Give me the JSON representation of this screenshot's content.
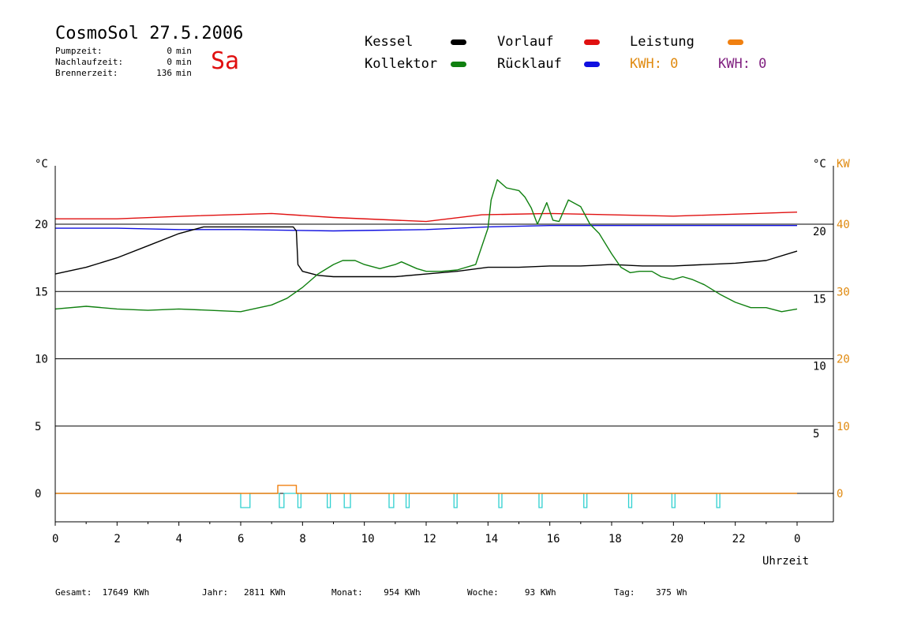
{
  "header": {
    "title": "CosmoSol 27.5.2006",
    "day": "Sa",
    "day_color": "#e01010",
    "info": [
      {
        "label": "Pumpzeit:",
        "value": "0",
        "unit": "min"
      },
      {
        "label": "Nachlaufzeit:",
        "value": "0",
        "unit": "min"
      },
      {
        "label": "Brennerzeit:",
        "value": "136",
        "unit": "min"
      }
    ]
  },
  "legend": {
    "items": [
      {
        "label": "Kessel",
        "color": "#000000"
      },
      {
        "label": "Vorlauf",
        "color": "#e01010"
      },
      {
        "label": "Leistung",
        "color": "#f08010"
      },
      {
        "label": "Kollektor",
        "color": "#108010"
      },
      {
        "label": "Rücklauf",
        "color": "#1010e0"
      }
    ],
    "kwh": [
      {
        "label": "KWH: 0",
        "color": "#e08a10"
      },
      {
        "label": "KWH: 0",
        "color": "#802080"
      }
    ]
  },
  "footer": {
    "gesamt": "Gesamt:  17649 KWh",
    "jahr": "Jahr:   2811 KWh",
    "monat": "Monat:    954 KWh",
    "woche": "Woche:     93 KWh",
    "tag": "Tag:    375 Wh"
  },
  "chart_data": {
    "type": "line",
    "xlabel": "Uhrzeit",
    "ylabel_left": "°C",
    "ylabel_right": [
      "°C",
      "KW"
    ],
    "xlim": [
      0,
      24
    ],
    "ylim": [
      0,
      25
    ],
    "x_ticks": [
      "0",
      "2",
      "4",
      "6",
      "8",
      "10",
      "12",
      "14",
      "16",
      "18",
      "20",
      "22",
      "0"
    ],
    "y_ticks_left": [
      "20",
      "15",
      "10",
      "5",
      "0"
    ],
    "y_ticks_right_c": [
      "20",
      "15",
      "10",
      "5"
    ],
    "y_ticks_right_kw": [
      "40",
      "30",
      "20",
      "10",
      "0"
    ],
    "grid": "horizontal",
    "series": [
      {
        "name": "Vorlauf",
        "color": "#e01010",
        "points": [
          [
            0,
            20.4
          ],
          [
            2,
            20.4
          ],
          [
            4.2,
            20.6
          ],
          [
            7,
            20.8
          ],
          [
            9,
            20.5
          ],
          [
            12,
            20.2
          ],
          [
            13.8,
            20.7
          ],
          [
            16,
            20.8
          ],
          [
            20,
            20.6
          ],
          [
            24,
            20.9
          ]
        ]
      },
      {
        "name": "Rücklauf",
        "color": "#1010e0",
        "points": [
          [
            0,
            19.7
          ],
          [
            2,
            19.7
          ],
          [
            4,
            19.6
          ],
          [
            6,
            19.6
          ],
          [
            9,
            19.5
          ],
          [
            12,
            19.6
          ],
          [
            14,
            19.8
          ],
          [
            16,
            19.9
          ],
          [
            20,
            19.9
          ],
          [
            24,
            19.9
          ]
        ]
      },
      {
        "name": "Kessel",
        "color": "#000000",
        "points": [
          [
            0,
            16.3
          ],
          [
            1,
            16.8
          ],
          [
            2,
            17.5
          ],
          [
            3,
            18.4
          ],
          [
            4,
            19.3
          ],
          [
            4.8,
            19.8
          ],
          [
            7.7,
            19.8
          ],
          [
            7.8,
            19.5
          ],
          [
            7.85,
            17
          ],
          [
            8,
            16.5
          ],
          [
            8.5,
            16.2
          ],
          [
            9,
            16.1
          ],
          [
            11,
            16.1
          ],
          [
            12,
            16.3
          ],
          [
            13,
            16.5
          ],
          [
            14,
            16.8
          ],
          [
            15,
            16.8
          ],
          [
            16,
            16.9
          ],
          [
            17,
            16.9
          ],
          [
            18,
            17
          ],
          [
            19,
            16.9
          ],
          [
            20,
            16.9
          ],
          [
            22,
            17.1
          ],
          [
            23,
            17.3
          ],
          [
            24,
            18
          ]
        ]
      },
      {
        "name": "Kollektor",
        "color": "#108010",
        "points": [
          [
            0,
            13.7
          ],
          [
            1,
            13.9
          ],
          [
            2,
            13.7
          ],
          [
            3,
            13.6
          ],
          [
            4,
            13.7
          ],
          [
            5,
            13.6
          ],
          [
            6,
            13.5
          ],
          [
            7,
            14
          ],
          [
            7.5,
            14.5
          ],
          [
            8,
            15.3
          ],
          [
            8.5,
            16.3
          ],
          [
            9,
            17
          ],
          [
            9.3,
            17.3
          ],
          [
            9.7,
            17.3
          ],
          [
            10,
            17
          ],
          [
            10.5,
            16.7
          ],
          [
            11,
            17
          ],
          [
            11.2,
            17.2
          ],
          [
            11.7,
            16.7
          ],
          [
            12,
            16.5
          ],
          [
            12.5,
            16.5
          ],
          [
            13,
            16.6
          ],
          [
            13.6,
            17
          ],
          [
            14,
            19.7
          ],
          [
            14.1,
            21.8
          ],
          [
            14.3,
            23.3
          ],
          [
            14.6,
            22.7
          ],
          [
            15,
            22.5
          ],
          [
            15.2,
            22
          ],
          [
            15.4,
            21.2
          ],
          [
            15.6,
            20
          ],
          [
            15.9,
            21.6
          ],
          [
            16.1,
            20.3
          ],
          [
            16.3,
            20.2
          ],
          [
            16.6,
            21.8
          ],
          [
            17,
            21.3
          ],
          [
            17.3,
            20
          ],
          [
            17.6,
            19.3
          ],
          [
            18,
            17.8
          ],
          [
            18.3,
            16.8
          ],
          [
            18.6,
            16.4
          ],
          [
            18.9,
            16.5
          ],
          [
            19.3,
            16.5
          ],
          [
            19.6,
            16.1
          ],
          [
            20,
            15.9
          ],
          [
            20.3,
            16.1
          ],
          [
            20.6,
            15.9
          ],
          [
            21,
            15.5
          ],
          [
            21.5,
            14.8
          ],
          [
            22,
            14.2
          ],
          [
            22.5,
            13.8
          ],
          [
            23,
            13.8
          ],
          [
            23.5,
            13.5
          ],
          [
            24,
            13.7
          ]
        ]
      },
      {
        "name": "Leistung",
        "color": "#f08010",
        "axis": "kw",
        "points": [
          [
            0,
            0
          ],
          [
            7.2,
            0
          ],
          [
            7.2,
            1.2
          ],
          [
            7.8,
            1.2
          ],
          [
            7.8,
            0
          ],
          [
            24,
            0
          ]
        ]
      }
    ],
    "brenner_pulses": [
      [
        6.0,
        6.3
      ],
      [
        7.25,
        7.4
      ],
      [
        7.85,
        7.95
      ],
      [
        8.8,
        8.9
      ],
      [
        9.35,
        9.55
      ],
      [
        10.8,
        10.95
      ],
      [
        11.35,
        11.45
      ],
      [
        12.9,
        13.0
      ],
      [
        14.35,
        14.45
      ],
      [
        15.65,
        15.75
      ],
      [
        17.1,
        17.2
      ],
      [
        18.55,
        18.65
      ],
      [
        19.95,
        20.05
      ],
      [
        21.4,
        21.5
      ]
    ],
    "brenner_color": "#30d0d0"
  }
}
